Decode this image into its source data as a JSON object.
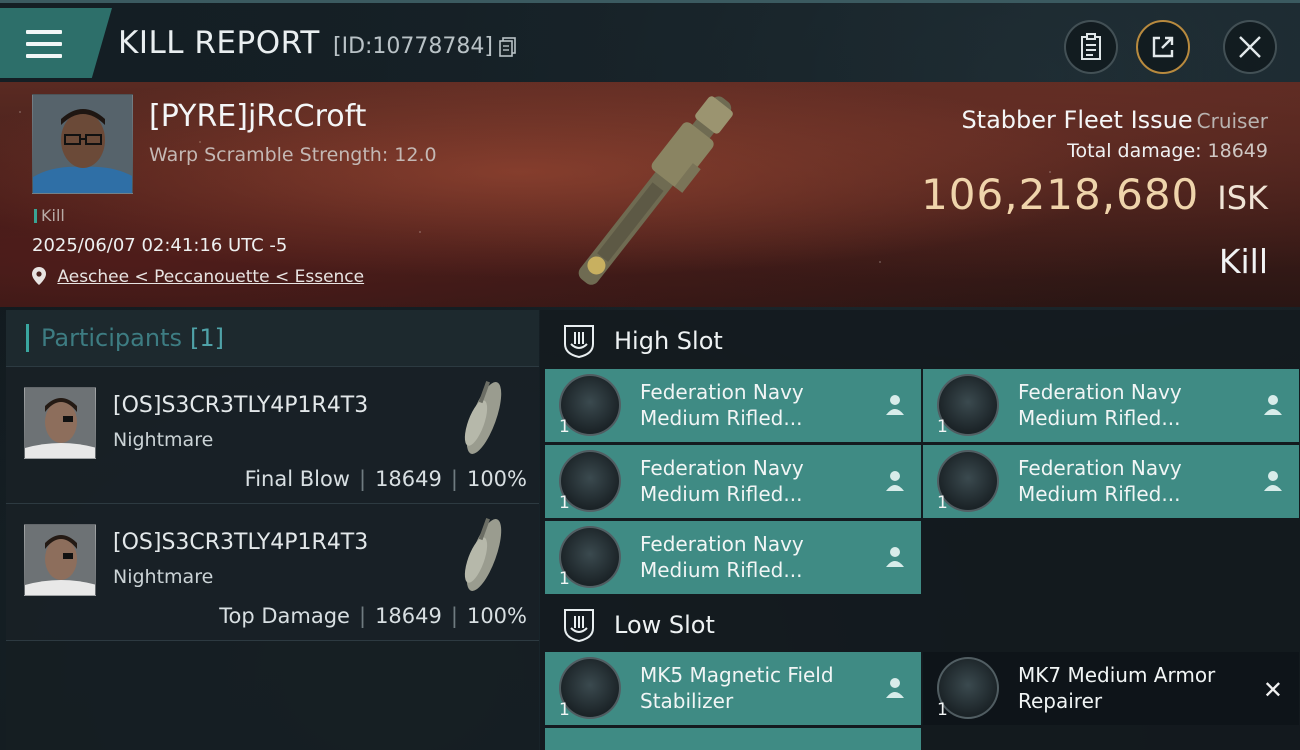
{
  "header": {
    "title": "KILL REPORT",
    "report_id": "[ID:10778784]"
  },
  "victim": {
    "name": "[PYRE]jRcCroft",
    "scramble": "Warp Scramble Strength: 12.0",
    "tag": "Kill",
    "datetime": "2025/06/07 02:41:16 UTC -5",
    "location": "Aeschee < Peccanouette < Essence",
    "ship": "Stabber Fleet Issue",
    "ship_class": "Cruiser",
    "total_damage_label": "Total damage:",
    "total_damage": "18649",
    "isk_value": "106,218,680",
    "isk_unit": "ISK",
    "result": "Kill"
  },
  "participants": {
    "label": "Participants",
    "count": "[1]",
    "rows": [
      {
        "name": "[OS]S3CR3TLY4P1R4T3",
        "ship": "Nightmare",
        "role": "Final Blow",
        "damage": "18649",
        "percent": "100%"
      },
      {
        "name": "[OS]S3CR3TLY4P1R4T3",
        "ship": "Nightmare",
        "role": "Top Damage",
        "damage": "18649",
        "percent": "100%"
      }
    ]
  },
  "fitting": {
    "high_slot_label": "High Slot",
    "low_slot_label": "Low Slot",
    "high": [
      {
        "name_1": "Federation Navy",
        "name_2": "Medium Rifled...",
        "qty": "1"
      },
      {
        "name_1": "Federation Navy",
        "name_2": "Medium Rifled...",
        "qty": "1"
      },
      {
        "name_1": "Federation Navy",
        "name_2": "Medium Rifled...",
        "qty": "1"
      },
      {
        "name_1": "Federation Navy",
        "name_2": "Medium Rifled...",
        "qty": "1"
      },
      {
        "name_1": "Federation Navy",
        "name_2": "Medium Rifled...",
        "qty": "1"
      }
    ],
    "low": [
      {
        "name_1": "MK5 Magnetic Field",
        "name_2": "Stabilizer",
        "qty": "1"
      },
      {
        "name_1": "MK7 Medium Armor",
        "name_2": "Repairer",
        "qty": "1"
      }
    ]
  },
  "colors": {
    "accent_teal": "#3f8b84",
    "isk_gold": "#efd4ab",
    "header_teal": "#2d6f6a"
  }
}
